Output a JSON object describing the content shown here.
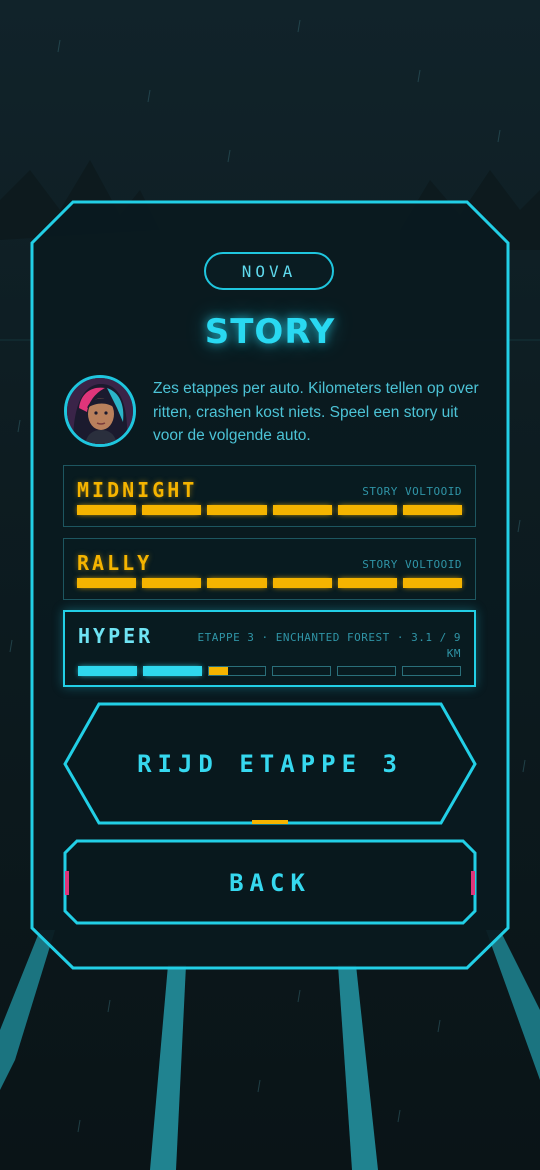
{
  "driver_badge": "NOVA",
  "screen_title": "STORY",
  "intro_text": "Zes etappes per auto. Kilometers tellen op over ritten, crashen kost niets. Speel een story uit voor de volgende auto.",
  "colors": {
    "accent": "#29d9f2",
    "gold": "#f5b400",
    "pink": "#e0357a",
    "background": "#0d1a1e"
  },
  "tracks": [
    {
      "name": "MIDNIGHT",
      "status": "STORY VOLTOOID",
      "active": false,
      "color": "#f5b400",
      "segments": [
        1,
        1,
        1,
        1,
        1,
        1
      ]
    },
    {
      "name": "RALLY",
      "status": "STORY VOLTOOID",
      "active": false,
      "color": "#f5b400",
      "segments": [
        1,
        1,
        1,
        1,
        1,
        1
      ]
    },
    {
      "name": "HYPER",
      "status": "ETAPPE 3 · ENCHANTED FOREST · 3.1 / 9 KM",
      "active": true,
      "color": "#2fd8ee",
      "segments": [
        1,
        1,
        0.34,
        0,
        0,
        0
      ]
    }
  ],
  "primary_button": "RIJD ETAPPE 3",
  "back_button": "BACK"
}
